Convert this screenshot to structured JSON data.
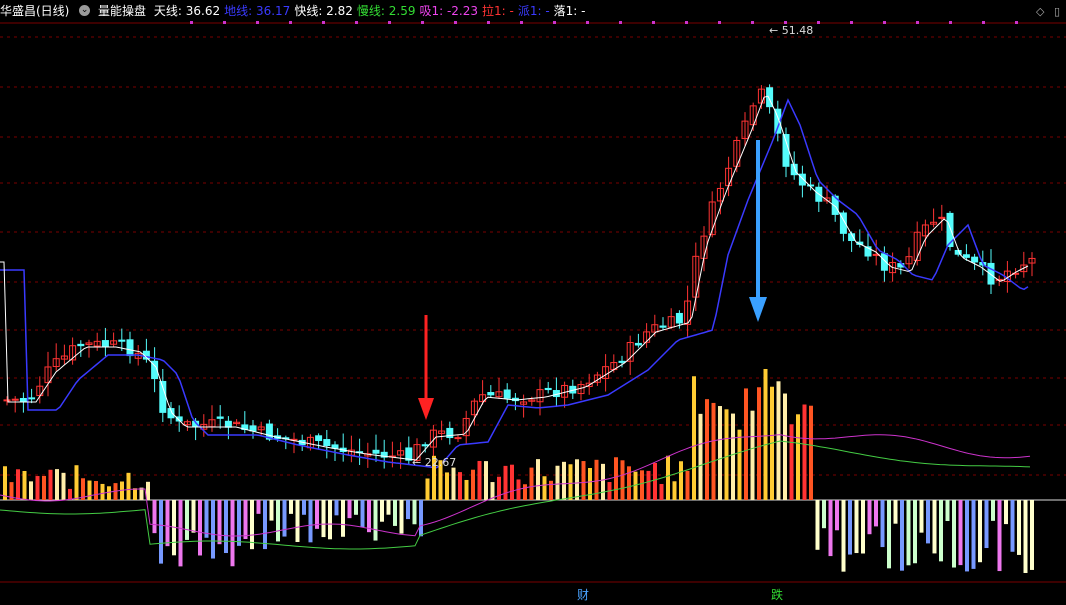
{
  "header": {
    "stock_name": "华盛昌(日线)",
    "indicator": "量能操盘",
    "items": [
      {
        "label": "天线:",
        "value": "36.62",
        "color": "#ffffff"
      },
      {
        "label": "地线:",
        "value": "36.17",
        "color": "#3a3aff"
      },
      {
        "label": "快线:",
        "value": "2.82",
        "color": "#ffffff"
      },
      {
        "label": "慢线:",
        "value": "2.59",
        "color": "#33dd33"
      },
      {
        "label": "吸1:",
        "value": "-2.23",
        "color": "#ee44ee"
      },
      {
        "label": "拉1:",
        "value": "-",
        "color": "#ff3333"
      },
      {
        "label": "派1:",
        "value": "-",
        "color": "#3a3aff"
      },
      {
        "label": "落1:",
        "value": "-",
        "color": "#ffffff"
      }
    ]
  },
  "annotations": {
    "high_label": "51.48",
    "low_label": "22.67"
  },
  "bottom_markers": [
    {
      "text": "财",
      "color": "#4aa3ff"
    },
    {
      "text": "跌",
      "color": "#33dd33"
    }
  ],
  "colors": {
    "up": "#ff3333",
    "down": "#54fcfc",
    "ma_fast": "#ffffff",
    "ma_slow": "#3a3aff",
    "grid": "#7a0000",
    "top_dots": "#cc33cc",
    "arrow_red": "#ff2222",
    "arrow_blue": "#3aa0ff",
    "sub_magenta": "#cc33cc",
    "sub_green": "#44cc44"
  },
  "icons": [
    "settings-toggle-icon",
    "diamond-icon",
    "expand-icon"
  ]
}
